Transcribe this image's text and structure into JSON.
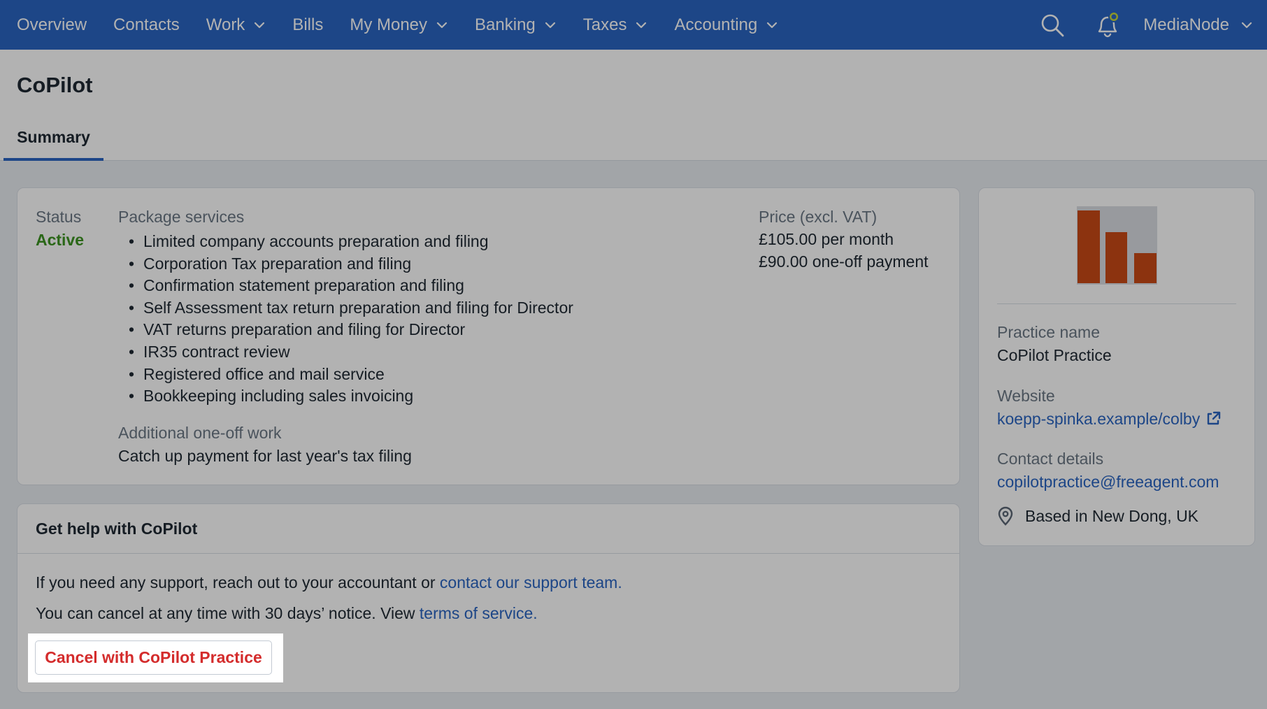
{
  "nav": {
    "items": [
      {
        "label": "Overview",
        "has_dropdown": false
      },
      {
        "label": "Contacts",
        "has_dropdown": false
      },
      {
        "label": "Work",
        "has_dropdown": true
      },
      {
        "label": "Bills",
        "has_dropdown": false
      },
      {
        "label": "My Money",
        "has_dropdown": true
      },
      {
        "label": "Banking",
        "has_dropdown": true
      },
      {
        "label": "Taxes",
        "has_dropdown": true
      },
      {
        "label": "Accounting",
        "has_dropdown": true
      }
    ],
    "account_label": "MediaNode",
    "icons": {
      "search": "search-icon",
      "notifications": "bell-icon"
    },
    "colors": {
      "bar": "#2a65c2",
      "text": "#ffffff",
      "notification_dot": "#c7d63a"
    }
  },
  "page": {
    "title": "CoPilot",
    "tabs": [
      {
        "label": "Summary",
        "active": true
      }
    ]
  },
  "summary": {
    "status_label": "Status",
    "status_value": "Active",
    "status_color": "#3d9422",
    "services_label": "Package services",
    "services": [
      "Limited company accounts preparation and filing",
      "Corporation Tax preparation and filing",
      "Confirmation statement preparation and filing",
      "Self Assessment tax return preparation and filing for Director",
      "VAT returns preparation and filing for Director",
      "IR35 contract review",
      "Registered office and mail service",
      "Bookkeeping including sales invoicing"
    ],
    "additional_label": "Additional one-off work",
    "additional_value": "Catch up payment for last year's tax filing",
    "price_label": "Price (excl. VAT)",
    "price_monthly": "£105.00 per month",
    "price_one_off": "£90.00 one-off payment"
  },
  "help": {
    "title": "Get help with CoPilot",
    "line1_text": "If you need any support, reach out to your accountant or ",
    "line1_link": "contact our support team.",
    "line2_text": "You can cancel at any time with 30 days’ notice. View ",
    "line2_link": "terms of service.",
    "cancel_label": "Cancel with CoPilot Practice",
    "cancel_color": "#d42c2c"
  },
  "practice": {
    "logo_icon": "bar-chart-logo",
    "logo_colors": {
      "bars": "#c94a16",
      "background": "#dadde3"
    },
    "name_label": "Practice name",
    "name_value": "CoPilot Practice",
    "website_label": "Website",
    "website_value": "koepp-spinka.example/colby",
    "contact_label": "Contact details",
    "contact_value": "copilotpractice@freeagent.com",
    "location": "Based in New Dong, UK",
    "link_color": "#2a65c2"
  }
}
